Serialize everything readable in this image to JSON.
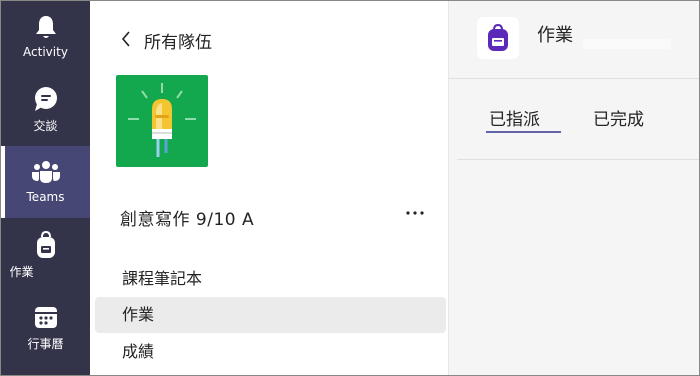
{
  "rail": {
    "items": [
      {
        "label": "Activity",
        "icon": "bell-icon"
      },
      {
        "label": "交談",
        "icon": "chat-icon"
      },
      {
        "label": "Teams",
        "icon": "teams-icon",
        "active": true
      },
      {
        "label": "作業",
        "icon": "backpack-icon"
      },
      {
        "label": "行事曆",
        "icon": "calendar-icon"
      }
    ]
  },
  "panel": {
    "back_label": "所有隊伍",
    "team_name": "創意寫作 9/10 A",
    "more_label": "⋯",
    "nav": [
      {
        "label": "課程筆記本"
      },
      {
        "label": "作業",
        "selected": true
      },
      {
        "label": "成績"
      }
    ]
  },
  "main": {
    "app_title": "作業",
    "tabs": [
      {
        "label": "已指派",
        "active": true
      },
      {
        "label": "已完成"
      }
    ]
  },
  "colors": {
    "rail_bg": "#33344a",
    "rail_active": "#464775",
    "accent": "#6264a7",
    "team_tile": "#13a74e",
    "assignments_icon": "#5b2ab8"
  }
}
